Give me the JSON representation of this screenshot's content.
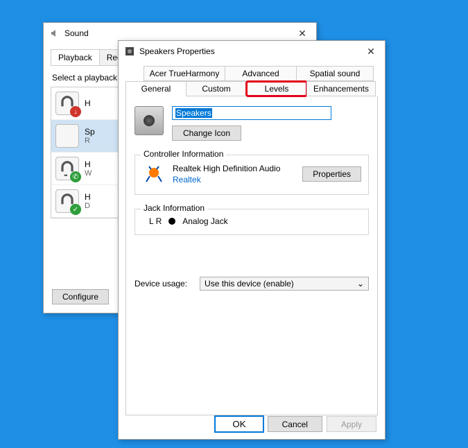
{
  "sound": {
    "title": "Sound",
    "tabs": [
      "Playback",
      "Recording"
    ],
    "select_label": "Select a playback device",
    "devices": [
      {
        "name": "H",
        "badge": "down"
      },
      {
        "name": "Sp",
        "sub": "R",
        "badge": "spk",
        "selected": true
      },
      {
        "name": "H",
        "sub": "W",
        "badge": "phone"
      },
      {
        "name": "H",
        "sub": "D",
        "badge": "check"
      }
    ],
    "configure_label": "Configure"
  },
  "props": {
    "title": "Speakers Properties",
    "tabs_row1": [
      "Acer TrueHarmony",
      "Advanced",
      "Spatial sound"
    ],
    "tabs_row2": [
      "General",
      "Custom",
      "Levels",
      "Enhancements"
    ],
    "active_tab": "General",
    "highlight_tab": "Levels",
    "name_value": "Speakers",
    "change_icon_label": "Change Icon",
    "controller": {
      "group_label": "Controller Information",
      "name": "Realtek High Definition Audio",
      "vendor": "Realtek",
      "properties_label": "Properties"
    },
    "jack": {
      "group_label": "Jack Information",
      "lr": "L R",
      "type": "Analog Jack"
    },
    "usage": {
      "label": "Device usage:",
      "value": "Use this device (enable)"
    },
    "buttons": {
      "ok": "OK",
      "cancel": "Cancel",
      "apply": "Apply"
    }
  }
}
